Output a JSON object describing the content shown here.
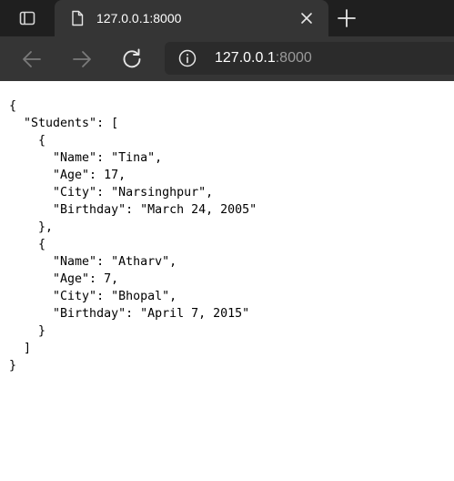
{
  "browser": {
    "tab": {
      "title": "127.0.0.1:8000"
    },
    "address_bar": {
      "host": "127.0.0.1",
      "port": ":8000"
    },
    "icons": {
      "tab_actions": "tab-actions-icon",
      "favicon": "page-icon",
      "close": "close-icon",
      "new_tab": "plus-icon",
      "back": "back-arrow-icon",
      "forward": "forward-arrow-icon",
      "reload": "reload-icon",
      "site_info": "info-icon"
    },
    "colors": {
      "tabbar_bg": "#1f1f1f",
      "toolbar_bg": "#353535",
      "addressbar_bg": "#2b2b2b",
      "url_host": "#ffffff",
      "url_port": "#9a9a9a"
    }
  },
  "page": {
    "json_lines": [
      "{",
      "  \"Students\": [",
      "    {",
      "      \"Name\": \"Tina\",",
      "      \"Age\": 17,",
      "      \"City\": \"Narsinghpur\",",
      "      \"Birthday\": \"March 24, 2005\"",
      "    },",
      "    {",
      "      \"Name\": \"Atharv\",",
      "      \"Age\": 7,",
      "      \"City\": \"Bhopal\",",
      "      \"Birthday\": \"April 7, 2015\"",
      "    }",
      "  ]",
      "}"
    ]
  }
}
